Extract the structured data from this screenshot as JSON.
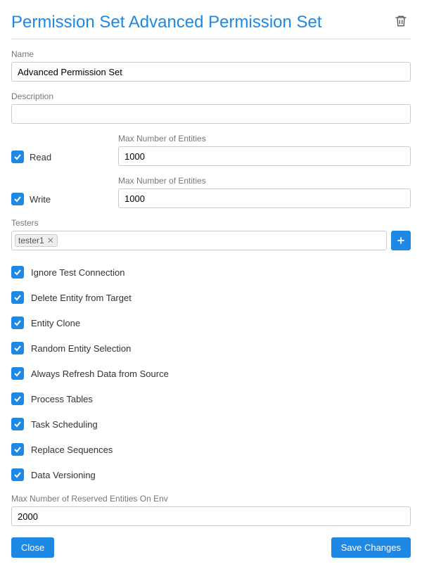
{
  "title": "Permission Set Advanced Permission Set",
  "name": {
    "label": "Name",
    "value": "Advanced Permission Set"
  },
  "description": {
    "label": "Description",
    "value": ""
  },
  "read": {
    "label": "Read",
    "max_label": "Max Number of Entities",
    "max_value": "1000"
  },
  "write": {
    "label": "Write",
    "max_label": "Max Number of Entities",
    "max_value": "1000"
  },
  "testers": {
    "label": "Testers",
    "tag": "tester1"
  },
  "checks": {
    "ignore_test_connection": "Ignore Test Connection",
    "delete_entity_from_target": "Delete Entity from Target",
    "entity_clone": "Entity Clone",
    "random_entity_selection": "Random Entity Selection",
    "always_refresh_data": "Always Refresh Data from Source",
    "process_tables": "Process Tables",
    "task_scheduling": "Task Scheduling",
    "replace_sequences": "Replace Sequences",
    "data_versioning": "Data Versioning"
  },
  "reserved": {
    "label": "Max Number of Reserved Entities On Env",
    "value": "2000"
  },
  "buttons": {
    "close": "Close",
    "save": "Save Changes"
  }
}
